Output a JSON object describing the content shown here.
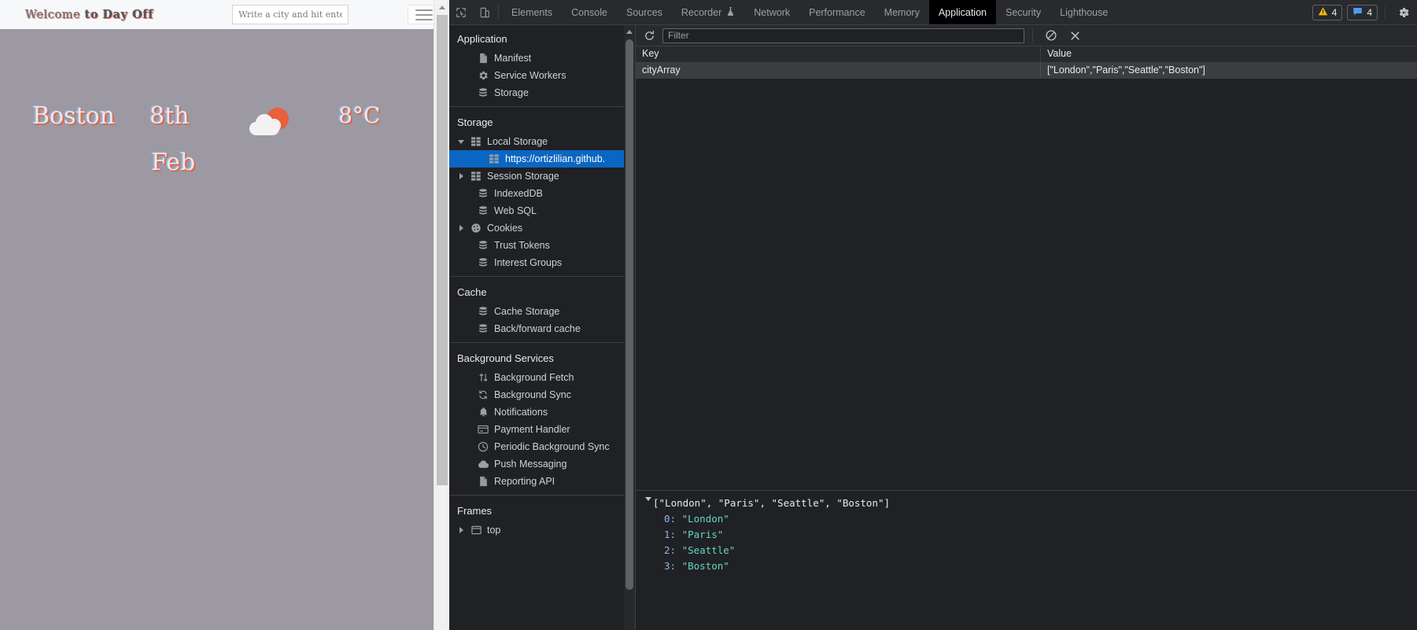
{
  "page": {
    "header": {
      "welcome_prefix": "Welcome",
      "welcome_mid": "to",
      "welcome_brand": "Day Off",
      "welcome_full": "Welcome to Day Off",
      "search_placeholder": "Write a city and hit enter",
      "search_value": "",
      "menu_icon": "hamburger-icon"
    },
    "weather": {
      "city": "Boston",
      "day": "8th",
      "month": "Feb",
      "temperature": "8°C",
      "condition_icon": "sun-behind-cloud-icon"
    },
    "colors": {
      "page_background": "#9c99a3",
      "header_background": "#f7f8fa",
      "accent_orange": "#e8603c",
      "text_light": "#e8e8ef"
    }
  },
  "devtools": {
    "tabs": [
      {
        "label": "Elements",
        "active": false
      },
      {
        "label": "Console",
        "active": false
      },
      {
        "label": "Sources",
        "active": false
      },
      {
        "label": "Recorder",
        "active": false,
        "icon": "flask-experiment-icon"
      },
      {
        "label": "Network",
        "active": false
      },
      {
        "label": "Performance",
        "active": false
      },
      {
        "label": "Memory",
        "active": false
      },
      {
        "label": "Application",
        "active": true
      },
      {
        "label": "Security",
        "active": false
      },
      {
        "label": "Lighthouse",
        "active": false
      }
    ],
    "left_icons": [
      {
        "name": "inspect-element-icon"
      },
      {
        "name": "device-toolbar-icon"
      }
    ],
    "badges": {
      "warnings_count": "4",
      "warnings_icon": "warning-triangle-icon",
      "messages_count": "4",
      "messages_icon": "message-bubble-icon",
      "settings_icon": "gear-icon"
    },
    "toolbar": {
      "refresh_icon": "refresh-icon",
      "filter_placeholder": "Filter",
      "filter_value": "",
      "clear_all_icon": "no-entry-clear-icon",
      "delete_selected_icon": "close-x-icon"
    },
    "sidebar": {
      "groups": [
        {
          "title": "Application",
          "items": [
            {
              "label": "Manifest",
              "icon": "document-icon",
              "twisty": "none",
              "indent": 1,
              "selected": false
            },
            {
              "label": "Service Workers",
              "icon": "gear-icon",
              "twisty": "none",
              "indent": 1,
              "selected": false
            },
            {
              "label": "Storage",
              "icon": "database-icon",
              "twisty": "none",
              "indent": 1,
              "selected": false
            }
          ]
        },
        {
          "title": "Storage",
          "items": [
            {
              "label": "Local Storage",
              "icon": "table-grid-icon",
              "twisty": "open",
              "indent": 0,
              "selected": false
            },
            {
              "label": "https://ortizlilian.github.",
              "icon": "table-grid-icon",
              "twisty": "none",
              "indent": 2,
              "selected": true
            },
            {
              "label": "Session Storage",
              "icon": "table-grid-icon",
              "twisty": "closed",
              "indent": 0,
              "selected": false
            },
            {
              "label": "IndexedDB",
              "icon": "database-icon",
              "twisty": "none",
              "indent": 1,
              "selected": false
            },
            {
              "label": "Web SQL",
              "icon": "database-icon",
              "twisty": "none",
              "indent": 1,
              "selected": false
            },
            {
              "label": "Cookies",
              "icon": "cookie-icon",
              "twisty": "closed",
              "indent": 0,
              "selected": false
            },
            {
              "label": "Trust Tokens",
              "icon": "database-icon",
              "twisty": "none",
              "indent": 1,
              "selected": false
            },
            {
              "label": "Interest Groups",
              "icon": "database-icon",
              "twisty": "none",
              "indent": 1,
              "selected": false
            }
          ]
        },
        {
          "title": "Cache",
          "items": [
            {
              "label": "Cache Storage",
              "icon": "database-icon",
              "twisty": "none",
              "indent": 1,
              "selected": false
            },
            {
              "label": "Back/forward cache",
              "icon": "database-icon",
              "twisty": "none",
              "indent": 1,
              "selected": false
            }
          ]
        },
        {
          "title": "Background Services",
          "items": [
            {
              "label": "Background Fetch",
              "icon": "up-down-arrows-icon",
              "twisty": "none",
              "indent": 1,
              "selected": false
            },
            {
              "label": "Background Sync",
              "icon": "sync-refresh-icon",
              "twisty": "none",
              "indent": 1,
              "selected": false
            },
            {
              "label": "Notifications",
              "icon": "bell-icon",
              "twisty": "none",
              "indent": 1,
              "selected": false
            },
            {
              "label": "Payment Handler",
              "icon": "credit-card-icon",
              "twisty": "none",
              "indent": 1,
              "selected": false
            },
            {
              "label": "Periodic Background Sync",
              "icon": "clock-icon",
              "twisty": "none",
              "indent": 1,
              "selected": false
            },
            {
              "label": "Push Messaging",
              "icon": "cloud-icon",
              "twisty": "none",
              "indent": 1,
              "selected": false
            },
            {
              "label": "Reporting API",
              "icon": "document-icon",
              "twisty": "none",
              "indent": 1,
              "selected": false
            }
          ]
        },
        {
          "title": "Frames",
          "items": [
            {
              "label": "top",
              "icon": "frame-icon",
              "twisty": "closed",
              "indent": 0,
              "selected": false
            }
          ]
        }
      ]
    },
    "grid": {
      "columns": [
        "Key",
        "Value"
      ],
      "rows": [
        {
          "key": "cityArray",
          "value": "[\"London\",\"Paris\",\"Seattle\",\"Boston\"]",
          "selected": true
        }
      ]
    },
    "preview": {
      "root": "[\"London\", \"Paris\", \"Seattle\", \"Boston\"]",
      "expanded": true,
      "entries": [
        {
          "index": "0:",
          "value": "\"London\""
        },
        {
          "index": "1:",
          "value": "\"Paris\""
        },
        {
          "index": "2:",
          "value": "\"Seattle\""
        },
        {
          "index": "3:",
          "value": "\"Boston\""
        }
      ]
    }
  }
}
